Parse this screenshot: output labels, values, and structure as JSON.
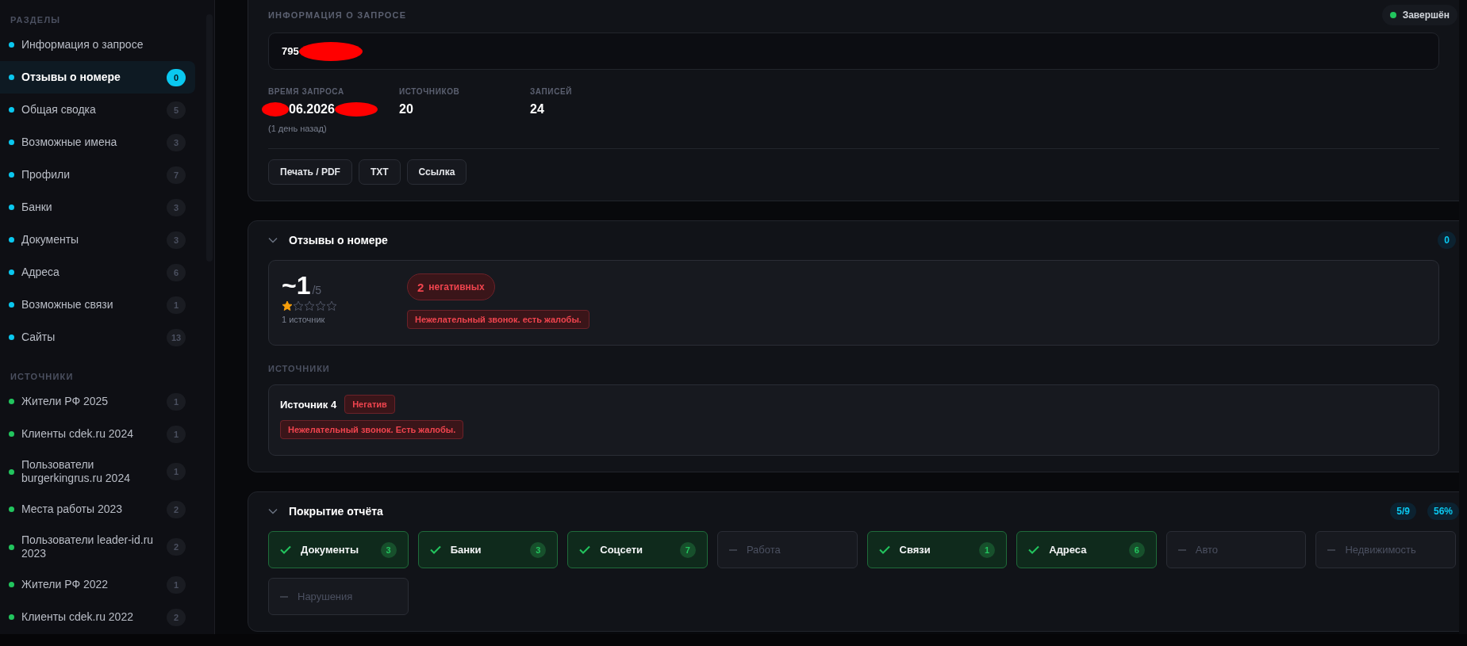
{
  "sidebar": {
    "sections_heading": "РАЗДЕЛЫ",
    "sections": [
      {
        "label": "Информация о запросе",
        "selected": false
      },
      {
        "label": "Отзывы о номере",
        "count": "0",
        "selected": true
      },
      {
        "label": "Общая сводка",
        "count": "5",
        "selected": false
      },
      {
        "label": "Возможные имена",
        "count": "3",
        "selected": false
      },
      {
        "label": "Профили",
        "count": "7",
        "selected": false
      },
      {
        "label": "Банки",
        "count": "3",
        "selected": false
      },
      {
        "label": "Документы",
        "count": "3",
        "selected": false
      },
      {
        "label": "Адреса",
        "count": "6",
        "selected": false
      },
      {
        "label": "Возможные связи",
        "count": "1",
        "selected": false
      },
      {
        "label": "Сайты",
        "count": "13",
        "selected": false
      }
    ],
    "sources_heading": "ИСТОЧНИКИ",
    "sources": [
      {
        "label": "Жители РФ 2025",
        "count": "1"
      },
      {
        "label": "Клиенты cdek.ru 2024",
        "count": "1"
      },
      {
        "label": "Пользователи burgerkingrus.ru 2024",
        "count": "1"
      },
      {
        "label": "Места работы 2023",
        "count": "2"
      },
      {
        "label": "Пользователи leader-id.ru 2023",
        "count": "2"
      },
      {
        "label": "Жители РФ 2022",
        "count": "1"
      },
      {
        "label": "Клиенты cdek.ru 2022",
        "count": "2"
      }
    ]
  },
  "request": {
    "title": "ИНФОРМАЦИЯ О ЗАПРОСЕ",
    "status": "Завершён",
    "phone": "795",
    "time_label": "ВРЕМЯ ЗАПРОСА",
    "time_value": "06.2026",
    "time_ago": "(1 день назад)",
    "sources_label": "ИСТОЧНИКОВ",
    "sources_value": "20",
    "records_label": "ЗАПИСЕЙ",
    "records_value": "24",
    "buttons": [
      "Печать / PDF",
      "TXT",
      "Ссылка"
    ]
  },
  "reviews": {
    "title": "Отзывы о номере",
    "expanded": true,
    "count": "0",
    "score": "~1",
    "score_max": "/5",
    "stars": 1,
    "source_count": "1 источник",
    "negatives_count": "2",
    "negatives_label": "негативных",
    "summary_tag": "Нежелательный звонок. есть жалобы.",
    "sources_heading": "ИСТОЧНИКИ",
    "sources": [
      {
        "name": "Источник 4",
        "verdict": "Негатив",
        "text": "Нежелательный звонок. Есть жалобы."
      }
    ]
  },
  "coverage": {
    "title": "Покрытие отчёта",
    "expanded": true,
    "count": "5/9",
    "percent": "56%",
    "items": [
      {
        "label": "Документы",
        "covered": true,
        "count": "3"
      },
      {
        "label": "Банки",
        "covered": true,
        "count": "3"
      },
      {
        "label": "Соцсети",
        "covered": true,
        "count": "7"
      },
      {
        "label": "Работа",
        "covered": false
      },
      {
        "label": "Связи",
        "covered": true,
        "count": "1"
      },
      {
        "label": "Адреса",
        "covered": true,
        "count": "6"
      },
      {
        "label": "Авто",
        "covered": false
      },
      {
        "label": "Недвижимость",
        "covered": false
      },
      {
        "label": "Нарушения",
        "covered": false
      }
    ]
  }
}
